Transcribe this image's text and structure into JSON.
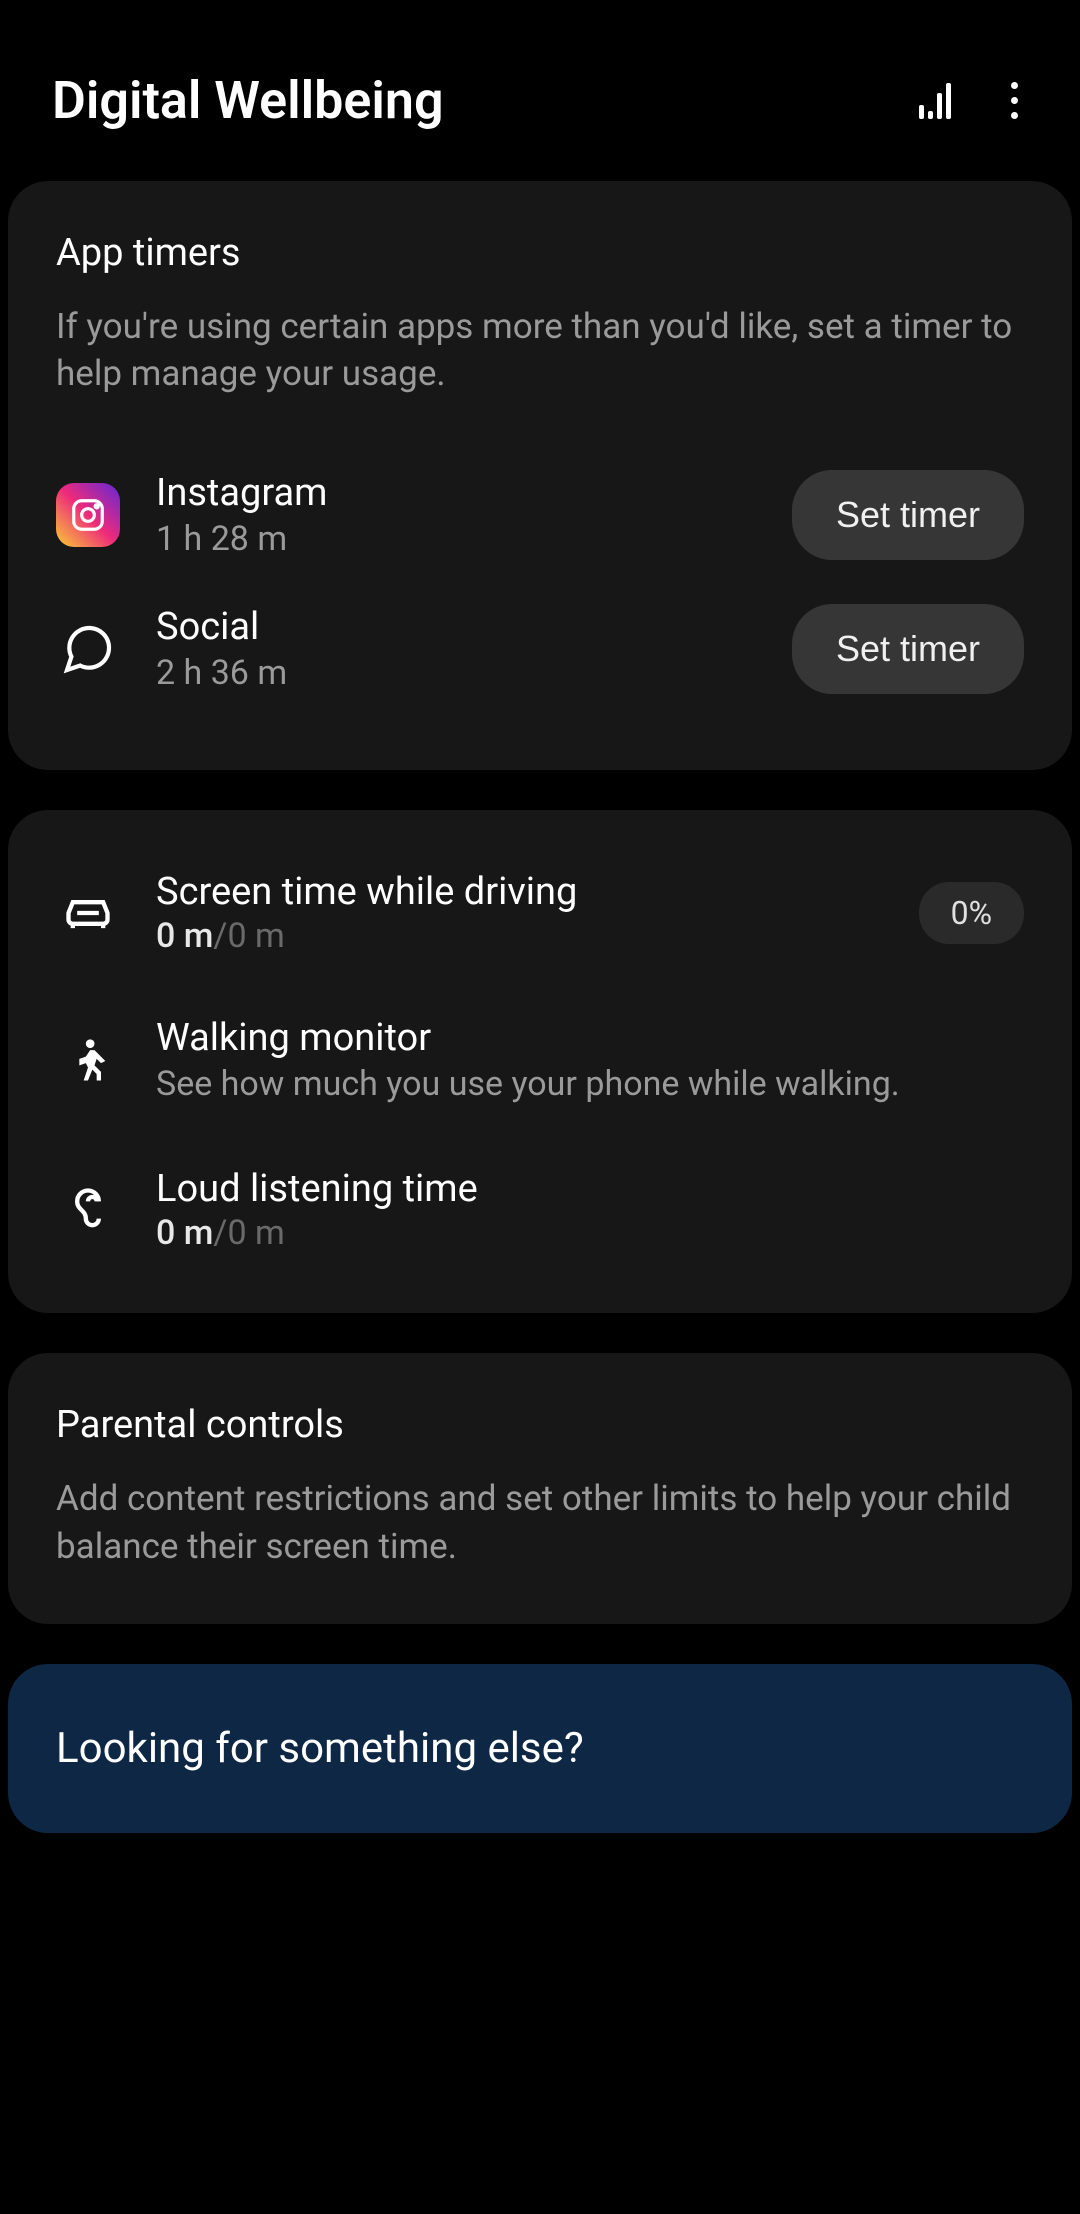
{
  "header": {
    "title": "Digital Wellbeing"
  },
  "app_timers": {
    "title": "App timers",
    "description": "If you're using certain apps more than you'd like, set a timer to help manage your usage.",
    "items": [
      {
        "name": "Instagram",
        "time": "1 h 28 m",
        "button": "Set timer"
      },
      {
        "name": "Social",
        "time": "2 h 36 m",
        "button": "Set timer"
      }
    ]
  },
  "metrics": {
    "driving": {
      "title": "Screen time while driving",
      "value_primary": "0 m",
      "value_separator": "/",
      "value_secondary": "0 m",
      "percent": "0%"
    },
    "walking": {
      "title": "Walking monitor",
      "description": "See how much you use your phone while walking."
    },
    "listening": {
      "title": "Loud listening time",
      "value_primary": "0 m",
      "value_separator": "/",
      "value_secondary": "0 m"
    }
  },
  "parental": {
    "title": "Parental controls",
    "description": "Add content restrictions and set other limits to help your child balance their screen time."
  },
  "footer": {
    "title": "Looking for something else?"
  }
}
